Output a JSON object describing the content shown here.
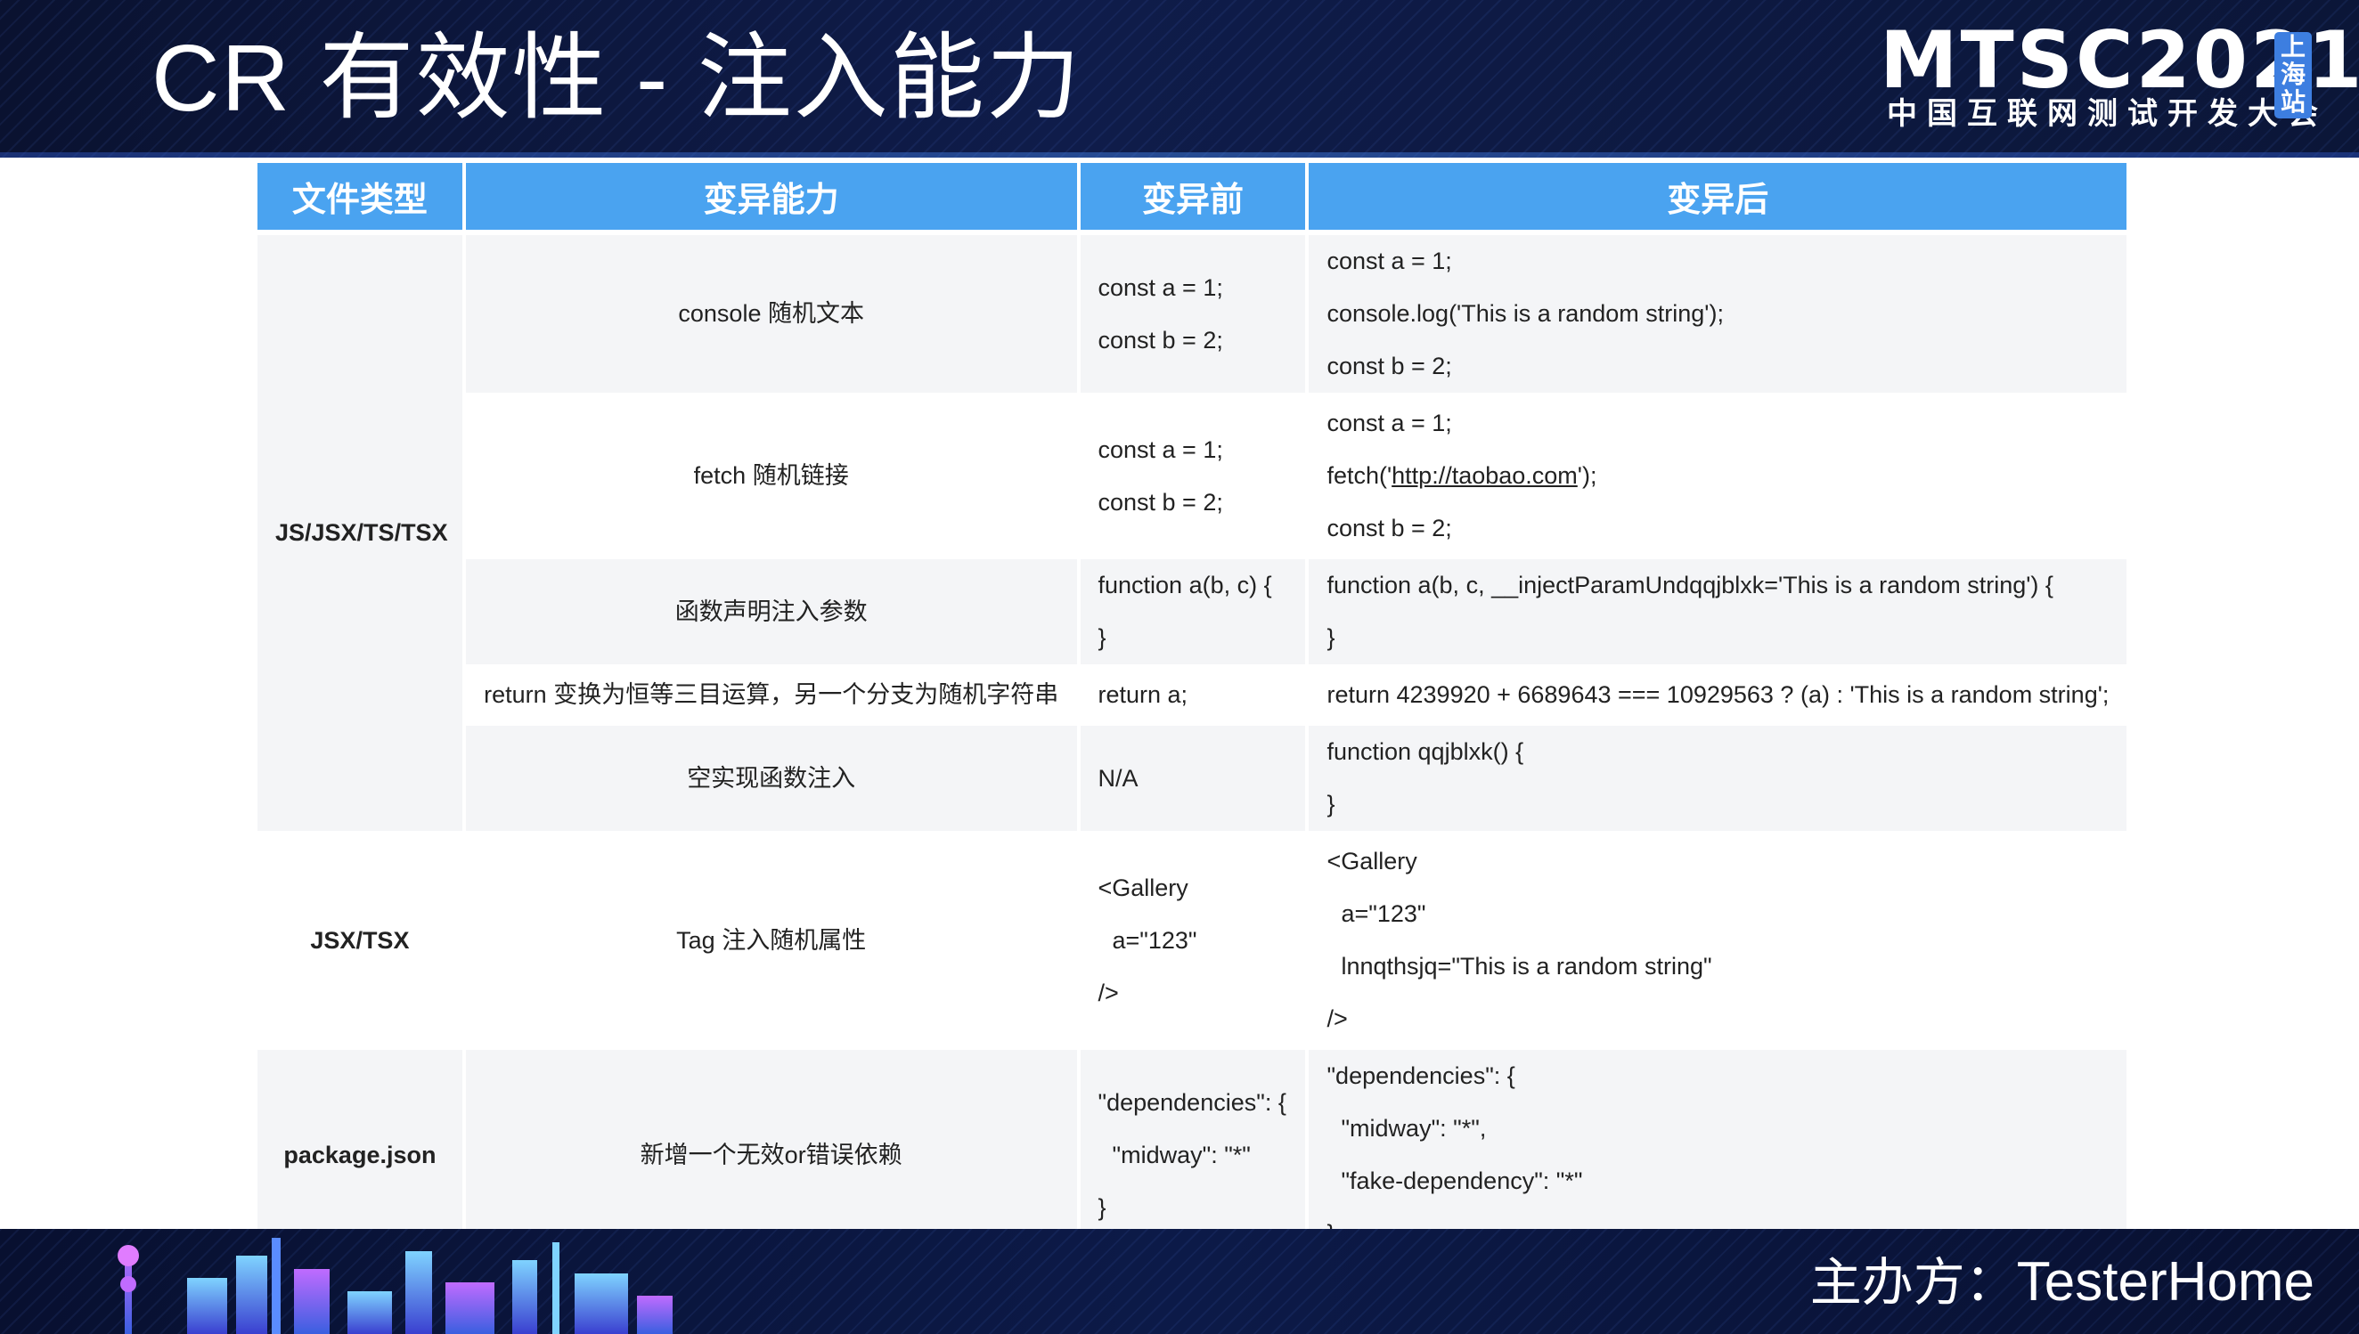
{
  "slide": {
    "title": "CR 有效性 - 注入能力"
  },
  "logo": {
    "mark": "MTSC2021",
    "subtitle": "中国互联网测试开发大会",
    "badge": [
      "上",
      "海",
      "站"
    ]
  },
  "table": {
    "headers": [
      "文件类型",
      "变异能力",
      "变异前",
      "变异后"
    ],
    "groups": [
      {
        "type": "JS/JSX/TS/TSX",
        "rows": [
          {
            "ability": "console 随机文本",
            "before": [
              "const a = 1;",
              "const b = 2;"
            ],
            "after": [
              "const a = 1;",
              "console.log('This is a random string');",
              "const b = 2;"
            ]
          },
          {
            "ability": "fetch 随机链接",
            "before": [
              "const a = 1;",
              "const b = 2;"
            ],
            "after_parts": {
              "prefix": "fetch('",
              "link": "http://taobao.com",
              "suffix": "');"
            },
            "after": [
              "const a = 1;",
              "fetch('http://taobao.com');",
              "const b = 2;"
            ]
          },
          {
            "ability": "函数声明注入参数",
            "before": [
              "function a(b, c) {",
              "}"
            ],
            "after": [
              "function a(b, c, __injectParamUndqqjblxk='This is a random string') {",
              "}"
            ]
          },
          {
            "ability": "return 变换为恒等三目运算，另一个分支为随机字符串",
            "before": [
              "return a;"
            ],
            "after": [
              "return 4239920 + 6689643 === 10929563 ? (a) : 'This is a random string';"
            ]
          },
          {
            "ability": "空实现函数注入",
            "before": [
              "N/A"
            ],
            "after": [
              "function qqjblxk() {",
              "}"
            ]
          }
        ]
      },
      {
        "type": "JSX/TSX",
        "rows": [
          {
            "ability": "Tag 注入随机属性",
            "before": [
              "<Gallery",
              "a=\"123\"",
              "/>"
            ],
            "after": [
              "<Gallery",
              "a=\"123\"",
              "lnnqthsjq=\"This is a random string\"",
              "/>"
            ]
          }
        ]
      },
      {
        "type": "package.json",
        "rows": [
          {
            "ability": "新增一个无效or错误依赖",
            "before": [
              "\"dependencies\": {",
              "\"midway\": \"*\"",
              "}"
            ],
            "after": [
              "\"dependencies\": {",
              "\"midway\": \"*\",",
              "\"fake-dependency\": \"*\"",
              "}"
            ]
          }
        ]
      }
    ]
  },
  "footer": {
    "organizer_label": "主办方：",
    "organizer_brand": "TesterHome"
  },
  "colors": {
    "header_bg": "#0f1c4a",
    "table_header": "#4aa3f0",
    "row_alt": "#f4f5f7",
    "logo_badge": "#3d7ee0"
  }
}
